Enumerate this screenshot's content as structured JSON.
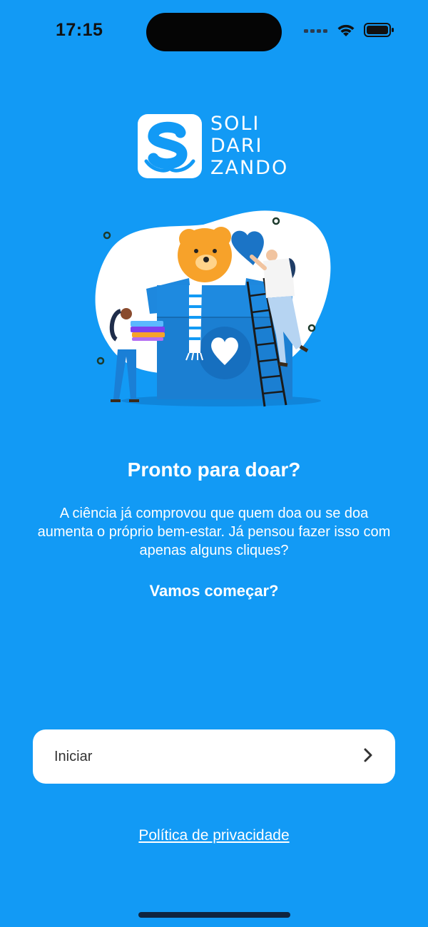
{
  "status_bar": {
    "time": "17:15",
    "icons": [
      "signal-icon",
      "wifi-icon",
      "battery-icon"
    ]
  },
  "logo": {
    "line1": "SOLI",
    "line2": "DARI",
    "line3": "ZANDO"
  },
  "content": {
    "headline": "Pronto para doar?",
    "description": "A ciência já comprovou que quem doa ou se doa aumenta o próprio bem-estar. Já pensou fazer isso com apenas alguns cliques?",
    "cta": "Vamos começar?"
  },
  "start_button": {
    "label": "Iniciar",
    "icon": "chevron-right-icon"
  },
  "privacy_link": "Política de privacidade",
  "colors": {
    "background": "#129af5",
    "button": "#ffffff",
    "box": "#1a85d8"
  }
}
